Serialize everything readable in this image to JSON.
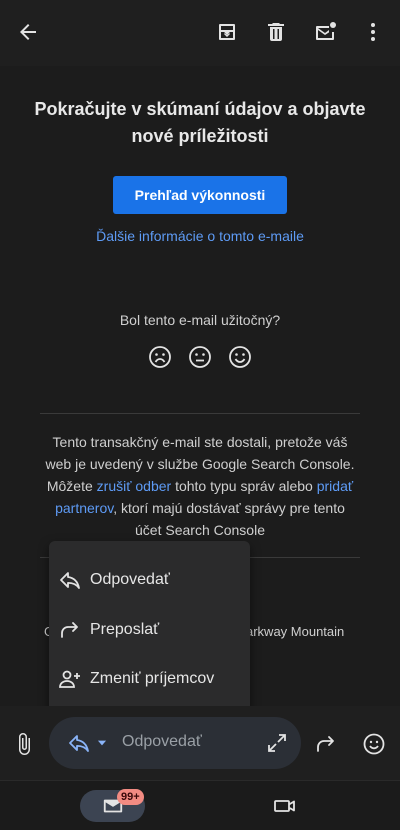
{
  "topbar": {
    "icons": [
      "back-arrow-icon",
      "archive-icon",
      "delete-icon",
      "mark-unread-icon",
      "more-vert-icon"
    ]
  },
  "email": {
    "headline": "Pokračujte v skúmaní údajov a objavte nové príležitosti",
    "cta_label": "Prehľad výkonnosti",
    "more_info_link": "Ďalšie informácie o tomto e-maile",
    "feedback_question": "Bol tento e-mail užitočný?",
    "feedback_faces": [
      "sad-face-icon",
      "neutral-face-icon",
      "happy-face-icon"
    ],
    "footer": {
      "part1": "Tento transakčný e-mail ste dostali, pretože váš web je uvedený v službe Google Search Console. Môžete ",
      "link_unsubscribe": "zrušiť odber",
      "part2": " tohto typu správ alebo ",
      "link_add_partners": "pridať partnerov",
      "part3": ", ktorí majú dostávať správy pre tento účet Search Console"
    },
    "address_left": "G",
    "address_right": "arkway Mountain"
  },
  "menu": {
    "items": [
      {
        "label": "Odpovedať",
        "icon": "reply-icon"
      },
      {
        "label": "Preposlať",
        "icon": "forward-icon"
      },
      {
        "label": "Zmeniť príjemcov",
        "icon": "change-recipients-icon"
      }
    ]
  },
  "replybar": {
    "placeholder": "Odpovedať",
    "icons": [
      "attach-icon",
      "reply-icon",
      "dropdown-icon",
      "expand-icon",
      "forward-icon",
      "emoji-icon"
    ]
  },
  "navbar": {
    "mail_badge": "99+",
    "icons": [
      "mail-icon",
      "video-icon"
    ]
  },
  "colors": {
    "accent": "#1a73e8",
    "link": "#5e9bf5",
    "badge": "#f28b82",
    "background": "#1f1f1f"
  }
}
